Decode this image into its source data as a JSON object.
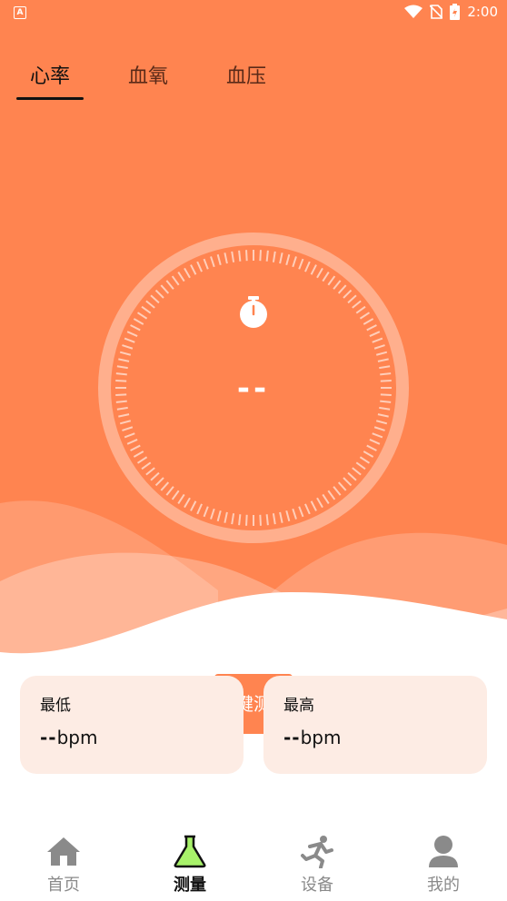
{
  "status_bar": {
    "time": "2:00",
    "app_indicator": "A"
  },
  "tabs": [
    {
      "label": "心率",
      "active": true
    },
    {
      "label": "血氧",
      "active": false
    },
    {
      "label": "血压",
      "active": false
    }
  ],
  "dial": {
    "icon": "stopwatch-icon",
    "value": "--"
  },
  "measure_button": {
    "label": "键测"
  },
  "stats": {
    "min": {
      "label": "最低",
      "value": "--",
      "unit": "bpm"
    },
    "max": {
      "label": "最高",
      "value": "--",
      "unit": "bpm"
    }
  },
  "nav": [
    {
      "label": "首页",
      "icon": "home-icon",
      "active": false
    },
    {
      "label": "测量",
      "icon": "flask-icon",
      "active": true
    },
    {
      "label": "设备",
      "icon": "running-icon",
      "active": false
    },
    {
      "label": "我的",
      "icon": "user-icon",
      "active": false
    }
  ],
  "colors": {
    "accent": "#ff8450",
    "card": "#fdece4",
    "flask": "#a8f26a",
    "inactive": "#8a8a8a"
  }
}
